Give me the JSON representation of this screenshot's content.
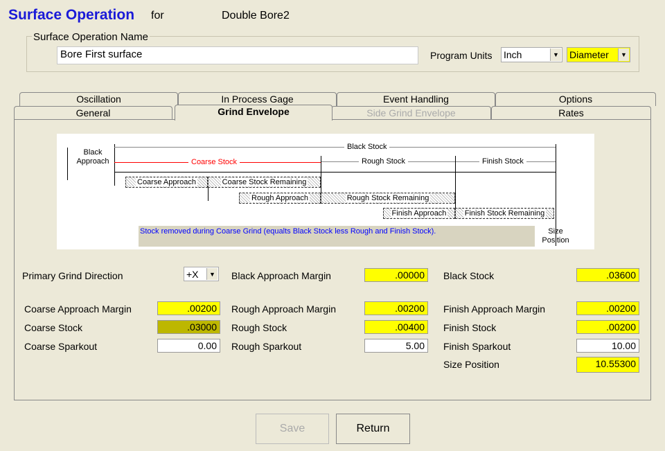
{
  "header": {
    "title": "Surface Operation",
    "for": "for",
    "operation": "Double Bore2"
  },
  "name_group": {
    "label": "Surface Operation Name",
    "value": "Bore First surface",
    "program_units_label": "Program Units",
    "units": "Inch",
    "mode": "Diameter"
  },
  "tabs_back": [
    "Oscillation",
    "In Process Gage",
    "Event Handling",
    "Options"
  ],
  "tabs_front": [
    "General",
    "Grind Envelope",
    "Side Grind Envelope",
    "Rates"
  ],
  "active_tab": "Grind Envelope",
  "diagram": {
    "black_approach": "Black Approach",
    "black_stock": "Black Stock",
    "coarse_stock": "Coarse Stock",
    "rough_stock": "Rough Stock",
    "finish_stock": "Finish Stock",
    "coarse_approach": "Coarse Approach",
    "coarse_stock_remaining": "Coarse Stock Remaining",
    "rough_approach": "Rough Approach",
    "rough_stock_remaining": "Rough Stock Remaining",
    "finish_approach": "Finish Approach",
    "finish_stock_remaining": "Finish Stock Remaining",
    "note": "Stock removed during Coarse Grind (equalts Black Stock less Rough and Finish Stock).",
    "size_position": "Size Position",
    "colors": {
      "coarse": "#ff0000",
      "note": "#0000ff"
    }
  },
  "fields": {
    "primary_dir": {
      "label": "Primary Grind Direction",
      "value": "+X"
    },
    "black_approach_margin": {
      "label": "Black Approach Margin",
      "value": ".00000"
    },
    "black_stock": {
      "label": "Black Stock",
      "value": ".03600"
    },
    "coarse_approach_margin": {
      "label": "Coarse Approach Margin",
      "value": ".00200"
    },
    "rough_approach_margin": {
      "label": "Rough Approach Margin",
      "value": ".00200"
    },
    "finish_approach_margin": {
      "label": "Finish Approach Margin",
      "value": ".00200"
    },
    "coarse_stock": {
      "label": "Coarse Stock",
      "value": ".03000"
    },
    "rough_stock": {
      "label": "Rough Stock",
      "value": ".00400"
    },
    "finish_stock": {
      "label": "Finish Stock",
      "value": ".00200"
    },
    "coarse_sparkout": {
      "label": "Coarse Sparkout",
      "value": "0.00"
    },
    "rough_sparkout": {
      "label": "Rough Sparkout",
      "value": "5.00"
    },
    "finish_sparkout": {
      "label": "Finish Sparkout",
      "value": "10.00"
    },
    "size_position": {
      "label": "Size Position",
      "value": "10.55300"
    }
  },
  "buttons": {
    "save": "Save",
    "return": "Return"
  }
}
